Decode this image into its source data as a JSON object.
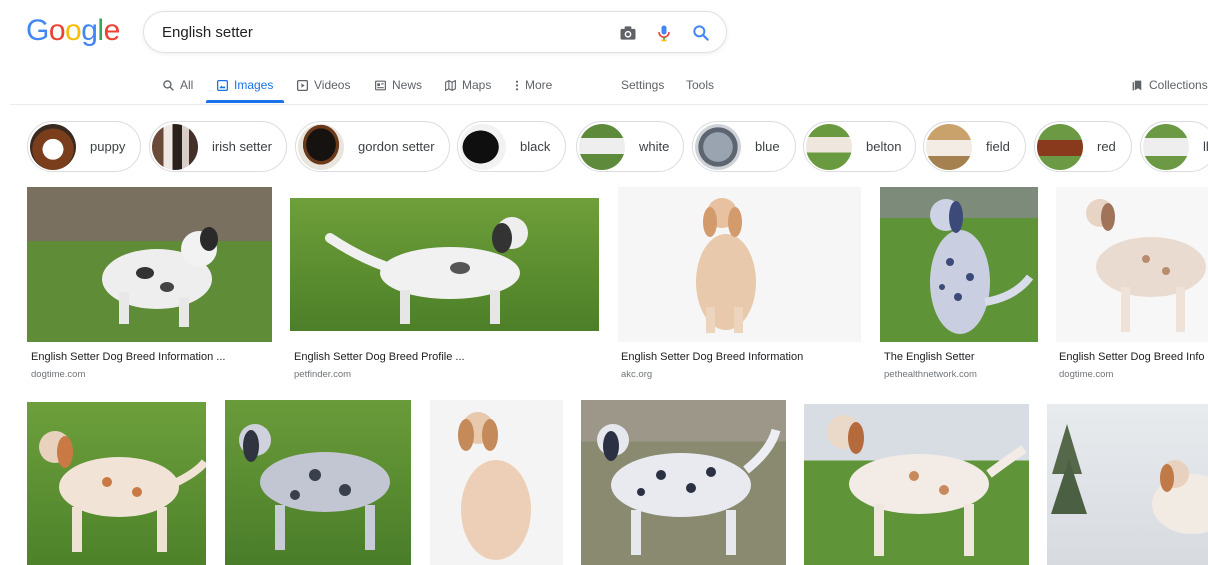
{
  "logo": {
    "letters": [
      "G",
      "o",
      "o",
      "g",
      "l",
      "e"
    ],
    "colors": [
      "#4285F4",
      "#EA4335",
      "#FBBC05",
      "#4285F4",
      "#34A853",
      "#EA4335"
    ]
  },
  "search": {
    "query": "English setter"
  },
  "tabs": [
    {
      "label": "All",
      "icon": "search-icon"
    },
    {
      "label": "Images",
      "icon": "image-icon",
      "active": true
    },
    {
      "label": "Videos",
      "icon": "video-icon"
    },
    {
      "label": "News",
      "icon": "news-icon"
    },
    {
      "label": "Maps",
      "icon": "map-icon"
    },
    {
      "label": "More",
      "icon": "more-vert-icon"
    }
  ],
  "tools": {
    "settings": "Settings",
    "tools": "Tools",
    "collections": "Collections"
  },
  "chips": [
    "puppy",
    "irish setter",
    "gordon setter",
    "black",
    "white",
    "blue",
    "belton",
    "field",
    "red",
    "ll"
  ],
  "results_row1": [
    {
      "title": "English Setter Dog Breed Information ...",
      "source": "dogtime.com"
    },
    {
      "title": "English Setter Dog Breed Profile ...",
      "source": "petfinder.com"
    },
    {
      "title": "English Setter Dog Breed Information",
      "source": "akc.org"
    },
    {
      "title": "The English Setter",
      "source": "pethealthnetwork.com"
    },
    {
      "title": "English Setter Dog Breed Info",
      "source": "dogtime.com"
    }
  ],
  "colors": {
    "accent": "#1a73e8",
    "text": "#202124",
    "muted": "#5f6368"
  }
}
